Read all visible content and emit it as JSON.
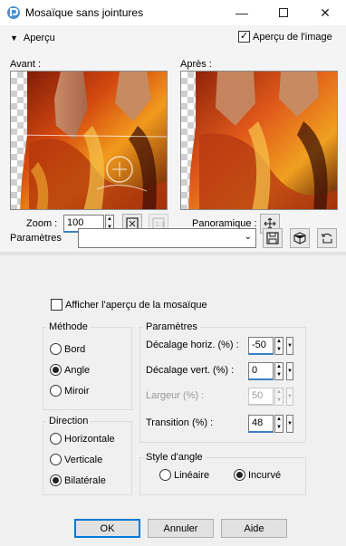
{
  "window": {
    "title": "Mosaïque sans jointures"
  },
  "preview_toggle": {
    "label": "Aperçu",
    "image_preview_label": "Aperçu de l'image",
    "image_preview_checked": true
  },
  "before": {
    "label": "Avant :"
  },
  "after": {
    "label": "Après :"
  },
  "zoom": {
    "label": "Zoom :",
    "value": "100"
  },
  "pan": {
    "label": "Panoramique :"
  },
  "presets": {
    "label": "Paramètres",
    "value": ""
  },
  "tile_preview": {
    "label": "Afficher l'aperçu de la mosaïque",
    "checked": false
  },
  "method": {
    "label": "Méthode",
    "options": [
      {
        "label": "Bord",
        "selected": false
      },
      {
        "label": "Angle",
        "selected": true
      },
      {
        "label": "Miroir",
        "selected": false
      }
    ]
  },
  "direction": {
    "label": "Direction",
    "options": [
      {
        "label": "Horizontale",
        "selected": false
      },
      {
        "label": "Verticale",
        "selected": false
      },
      {
        "label": "Bilatérale",
        "selected": true
      }
    ]
  },
  "params": {
    "label": "Paramètres",
    "horiz": {
      "label": "Décalage horiz. (%) :",
      "value": "-50"
    },
    "vert": {
      "label": "Décalage vert. (%) :",
      "value": "0"
    },
    "width": {
      "label": "Largeur (%) :",
      "value": "50"
    },
    "transition": {
      "label": "Transition (%) :",
      "value": "48"
    }
  },
  "corner_style": {
    "label": "Style d'angle",
    "options": [
      {
        "label": "Linéaire",
        "selected": false
      },
      {
        "label": "Incurvé",
        "selected": true
      }
    ]
  },
  "buttons": {
    "ok": "OK",
    "cancel": "Annuler",
    "help": "Aide"
  },
  "colors": {
    "accent": "#0078d7",
    "panel": "#f0f0f0"
  }
}
